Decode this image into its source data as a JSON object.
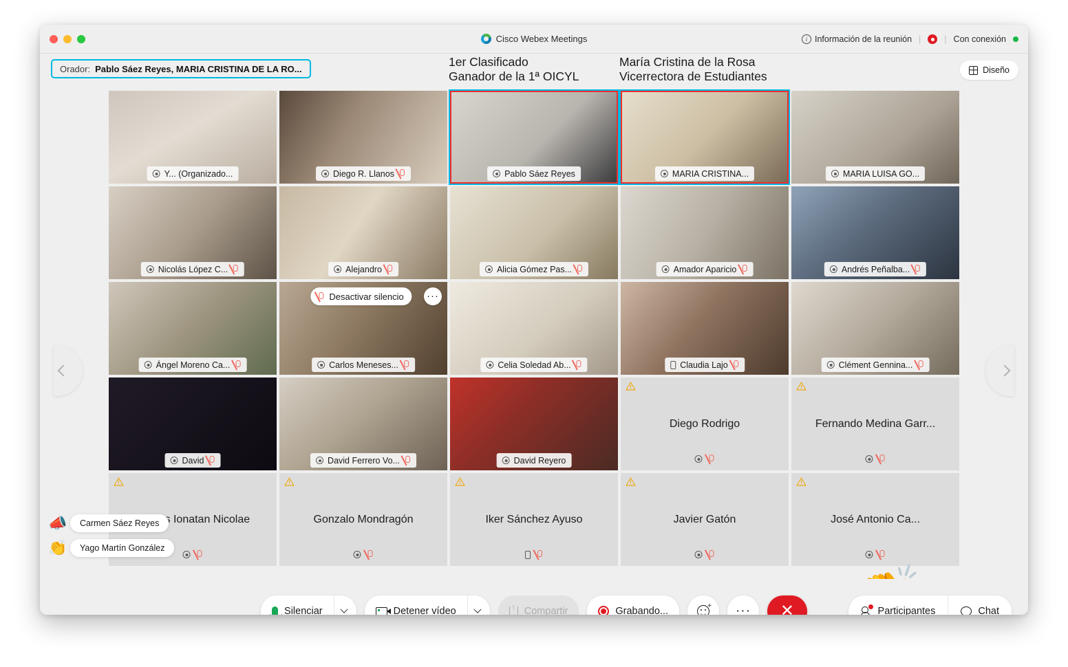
{
  "window": {
    "app_title": "Cisco Webex Meetings",
    "meeting_info": "Información de la reunión",
    "connection_status": "Con conexión"
  },
  "subheader": {
    "speaker_label": "Orador:",
    "speaker_names": "Pablo Sáez Reyes,   MARIA CRISTINA DE LA RO...",
    "annotation_left": "1er Clasificado\nGanador de la 1ª OICYL",
    "annotation_right": "María Cristina de la Rosa\nVicerrectora de Estudiantes",
    "layout_button": "Diseño"
  },
  "hover_controls": {
    "unmute_label": "Desactivar silencio",
    "more_label": "···"
  },
  "tiles": [
    {
      "name": "Y...  (Organizado...",
      "type": "video",
      "audio": "headset",
      "muted": false,
      "active": false,
      "scene": "s1"
    },
    {
      "name": "Diego R. Llanos",
      "type": "video",
      "audio": "headset",
      "muted": true,
      "active": false,
      "scene": "s2"
    },
    {
      "name": "Pablo Sáez Reyes",
      "type": "video",
      "audio": "headset",
      "muted": false,
      "active": true,
      "scene": "s3"
    },
    {
      "name": "MARIA CRISTINA...",
      "type": "video",
      "audio": "headset",
      "muted": false,
      "active": true,
      "scene": "s4"
    },
    {
      "name": "MARIA LUISA GO...",
      "type": "video",
      "audio": "headset",
      "muted": false,
      "active": false,
      "scene": "s5"
    },
    {
      "name": "Nicolás López C...",
      "type": "video",
      "audio": "headset",
      "muted": true,
      "active": false,
      "scene": "s6"
    },
    {
      "name": "Alejandro",
      "type": "video",
      "audio": "headset",
      "muted": true,
      "active": false,
      "scene": "s7"
    },
    {
      "name": "Alicia Gómez Pas...",
      "type": "video",
      "audio": "headset",
      "muted": true,
      "active": false,
      "scene": "s8"
    },
    {
      "name": "Amador Aparicio",
      "type": "video",
      "audio": "headset",
      "muted": true,
      "active": false,
      "scene": "s9"
    },
    {
      "name": "Andrés Peñalba...",
      "type": "video",
      "audio": "headset",
      "muted": true,
      "active": false,
      "scene": "s10"
    },
    {
      "name": "Ángel Moreno Ca...",
      "type": "video",
      "audio": "headset",
      "muted": true,
      "active": false,
      "scene": "s11"
    },
    {
      "name": "Carlos Meneses...",
      "type": "video",
      "audio": "headset",
      "muted": true,
      "active": false,
      "scene": "s12",
      "hover": true
    },
    {
      "name": "Celia Soledad Ab...",
      "type": "video",
      "audio": "headset",
      "muted": true,
      "active": false,
      "scene": "s13"
    },
    {
      "name": "Claudia Lajo",
      "type": "video",
      "audio": "phone",
      "muted": true,
      "active": false,
      "scene": "s14"
    },
    {
      "name": "Clément Gennina...",
      "type": "video",
      "audio": "headset",
      "muted": true,
      "active": false,
      "scene": "s15"
    },
    {
      "name": "David",
      "type": "video",
      "audio": "headset",
      "muted": true,
      "active": false,
      "scene": "s16"
    },
    {
      "name": "David Ferrero Vo...",
      "type": "video",
      "audio": "headset",
      "muted": true,
      "active": false,
      "scene": "s17"
    },
    {
      "name": "David Reyero",
      "type": "video",
      "audio": "headset",
      "muted": false,
      "active": false,
      "scene": "s18"
    },
    {
      "name": "Diego Rodrigo",
      "type": "placeholder",
      "audio": "headset",
      "muted": true,
      "warning": true
    },
    {
      "name": "Fernando Medina Garr...",
      "type": "placeholder",
      "audio": "headset",
      "muted": true,
      "warning": true
    },
    {
      "name": "Flavius Ionatan Nicolae",
      "type": "placeholder",
      "audio": "headset",
      "muted": true,
      "warning": true
    },
    {
      "name": "Gonzalo Mondragón",
      "type": "placeholder",
      "audio": "headset",
      "muted": true,
      "warning": true
    },
    {
      "name": "Iker Sánchez Ayuso",
      "type": "placeholder",
      "audio": "phone",
      "muted": true,
      "warning": true
    },
    {
      "name": "Javier Gatón",
      "type": "placeholder",
      "audio": "headset",
      "muted": true,
      "warning": true
    },
    {
      "name": "José Antonio Ca...",
      "type": "placeholder",
      "audio": "headset",
      "muted": true,
      "warning": true
    }
  ],
  "reactions": [
    {
      "emoji": "📣",
      "name": "Carmen Sáez Reyes"
    },
    {
      "emoji": "👏",
      "name": "Yago Martín González"
    }
  ],
  "floating_reaction": {
    "emoji": "👏"
  },
  "toolbar": {
    "mute_label": "Silenciar",
    "video_label": "Detener vídeo",
    "share_label": "Compartir",
    "recording_label": "Grabando...",
    "participants_label": "Participantes",
    "chat_label": "Chat"
  },
  "colors": {
    "accent_blue": "#00b8e4",
    "active_red": "#ef2d2d",
    "end_red": "#e01a22",
    "online_green": "#18b848",
    "warning_amber": "#f0a500",
    "window_bg": "#efefef"
  }
}
